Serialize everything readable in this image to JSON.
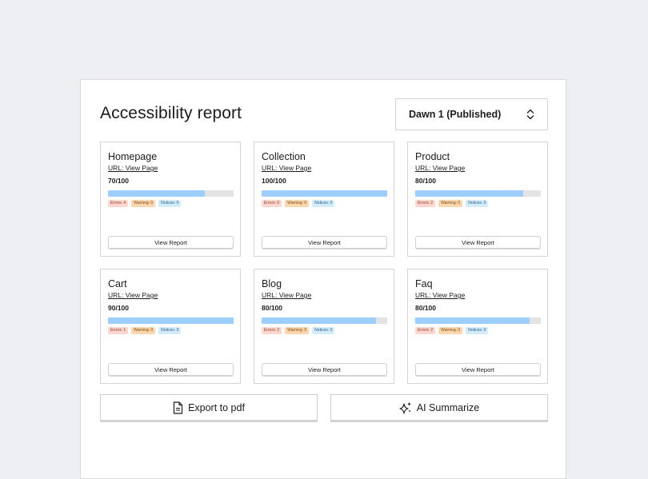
{
  "page": {
    "title": "Accessibility report",
    "theme_select": {
      "value": "Dawn 1 (Published)"
    }
  },
  "cards": [
    {
      "name": "Homepage",
      "url": "URL: View Page",
      "score": "70/100",
      "progress": 0.77,
      "errors": "Errors: 4",
      "warnings": "Warning: 0",
      "notices": "Notices: 0",
      "button": "View Report"
    },
    {
      "name": "Collection",
      "url": "URL: View Page",
      "score": "100/100",
      "progress": 1.0,
      "errors": "Errors: 0",
      "warnings": "Warning: 0",
      "notices": "Notices: 0",
      "button": "View Report"
    },
    {
      "name": "Product",
      "url": "URL: View Page",
      "score": "80/100",
      "progress": 0.86,
      "errors": "Errors: 2",
      "warnings": "Warning: 0",
      "notices": "Notices: 0",
      "button": "View Report"
    },
    {
      "name": "Cart",
      "url": "URL: View Page",
      "score": "90/100",
      "progress": 1.0,
      "errors": "Errors: 1",
      "warnings": "Warning: 0",
      "notices": "Notices: 0",
      "button": "View Report"
    },
    {
      "name": "Blog",
      "url": "URL: View Page",
      "score": "80/100",
      "progress": 0.91,
      "errors": "Errors: 2",
      "warnings": "Warning: 0",
      "notices": "Notices: 0",
      "button": "View Report"
    },
    {
      "name": "Faq",
      "url": "URL: View Page",
      "score": "80/100",
      "progress": 0.91,
      "errors": "Errors: 2",
      "warnings": "Warning: 0",
      "notices": "Notices: 0",
      "button": "View Report"
    }
  ],
  "actions": {
    "export_label": "Export to pdf",
    "export_icon": "document-icon",
    "summarize_label": "AI Summarize",
    "summarize_icon": "sparkles-icon"
  },
  "colors": {
    "progress_fill": "#9ccfff",
    "progress_track": "#e3e3e3",
    "error_badge": "#fdd7cf",
    "warning_badge": "#fcd6ad",
    "notice_badge": "#d3ecfc"
  }
}
